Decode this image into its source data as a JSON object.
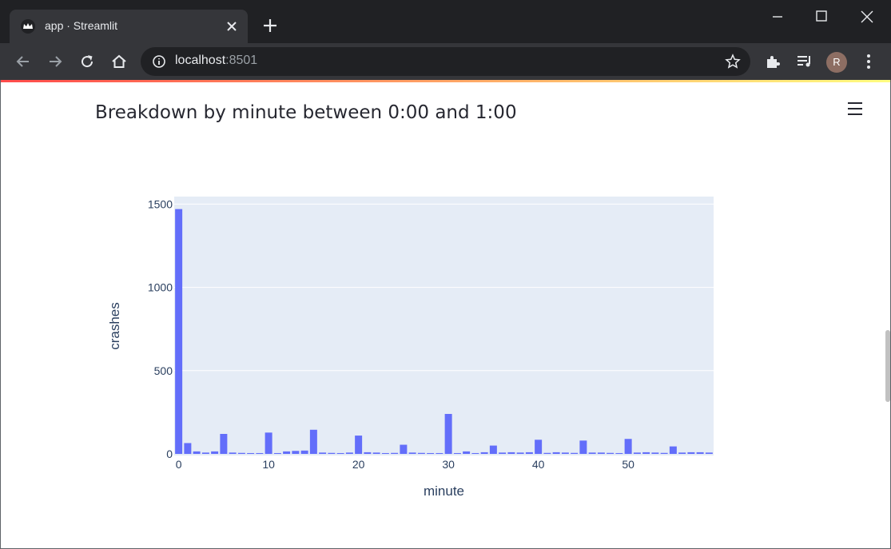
{
  "browser": {
    "tab_title": "app · Streamlit",
    "url_host": "localhost",
    "url_port": ":8501",
    "profile_initial": "R"
  },
  "page": {
    "title": "Breakdown by minute between 0:00 and 1:00"
  },
  "colors": {
    "bar": "#636efa",
    "plot_bg": "#e5ecf6",
    "accent_start": "#ff4b4b",
    "accent_end": "#fffd80"
  },
  "chart_data": {
    "type": "bar",
    "xlabel": "minute",
    "ylabel": "crashes",
    "xlim": [
      -0.5,
      59.5
    ],
    "ylim": [
      0,
      1500
    ],
    "x_ticks": [
      0,
      10,
      20,
      30,
      40,
      50
    ],
    "y_ticks": [
      0,
      500,
      1000,
      1500
    ],
    "grid": true,
    "x": [
      0,
      1,
      2,
      3,
      4,
      5,
      6,
      7,
      8,
      9,
      10,
      11,
      12,
      13,
      14,
      15,
      16,
      17,
      18,
      19,
      20,
      21,
      22,
      23,
      24,
      25,
      26,
      27,
      28,
      29,
      30,
      31,
      32,
      33,
      34,
      35,
      36,
      37,
      38,
      39,
      40,
      41,
      42,
      43,
      44,
      45,
      46,
      47,
      48,
      49,
      50,
      51,
      52,
      53,
      54,
      55,
      56,
      57,
      58,
      59
    ],
    "values": [
      1470,
      65,
      15,
      8,
      15,
      120,
      8,
      6,
      5,
      5,
      128,
      5,
      15,
      18,
      20,
      145,
      8,
      6,
      5,
      8,
      110,
      10,
      8,
      5,
      6,
      55,
      8,
      6,
      5,
      5,
      240,
      5,
      15,
      5,
      10,
      50,
      8,
      10,
      8,
      10,
      85,
      6,
      10,
      8,
      6,
      80,
      8,
      8,
      6,
      5,
      90,
      8,
      10,
      8,
      6,
      45,
      8,
      10,
      10,
      8
    ]
  }
}
